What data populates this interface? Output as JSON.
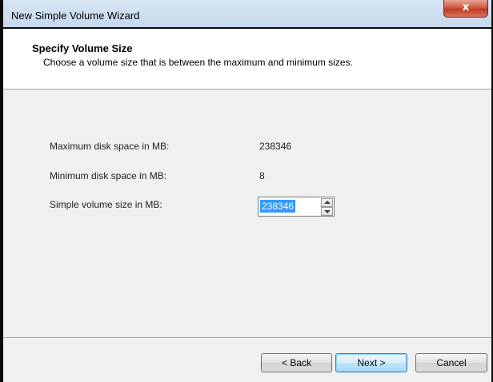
{
  "window": {
    "title": "New Simple Volume Wizard",
    "close_glyph": "x"
  },
  "header": {
    "title": "Specify Volume Size",
    "subtitle": "Choose a volume size that is between the maximum and minimum sizes."
  },
  "fields": {
    "max_label": "Maximum disk space in MB:",
    "max_value": "238346",
    "min_label": "Minimum disk space in MB:",
    "min_value": "8",
    "size_label": "Simple volume size in MB:",
    "size_value": "238346"
  },
  "buttons": {
    "back": "< Back",
    "next": "Next >",
    "cancel": "Cancel"
  },
  "colors": {
    "selection": "#3399ff",
    "close_button": "#c03a22"
  }
}
